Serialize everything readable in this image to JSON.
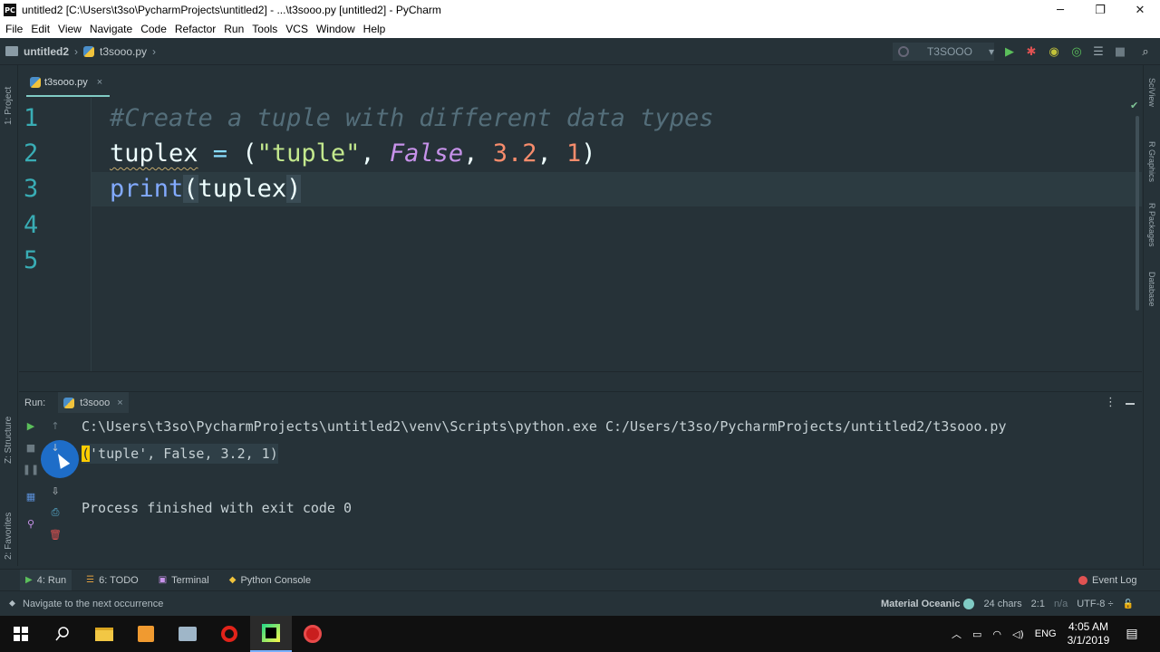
{
  "window": {
    "app_icon": "PC",
    "title": "untitled2 [C:\\Users\\t3so\\PycharmProjects\\untitled2] - ...\\t3sooo.py [untitled2] - PyCharm",
    "minimize": "─",
    "maximize": "❐",
    "close": "✕"
  },
  "menu": [
    "File",
    "Edit",
    "View",
    "Navigate",
    "Code",
    "Refactor",
    "Run",
    "Tools",
    "VCS",
    "Window",
    "Help"
  ],
  "breadcrumb": {
    "project": "untitled2",
    "file": "t3sooo.py",
    "sep": "›"
  },
  "run_config": {
    "name": "T3SOOO",
    "arrow": "▾"
  },
  "toolbar_icons": {
    "run": "▶",
    "debug": "✱",
    "coverage": "◉",
    "profile": "◎",
    "concurrency": "☰",
    "stop": "■",
    "search": "⌕"
  },
  "left_strip": {
    "project": "1: Project",
    "structure": "Z: Structure",
    "favorites": "2: Favorites"
  },
  "right_strip": {
    "sciview": "SciView",
    "rgraphics": "R Graphics",
    "rpackages": "R Packages",
    "database": "Database"
  },
  "editor_tab": {
    "label": "t3sooo.py",
    "close": "×"
  },
  "editor": {
    "line_numbers": [
      "1",
      "2",
      "3",
      "4",
      "5"
    ],
    "line1_comment": "#Create a tuple with different data types",
    "line2": {
      "var": "tuplex",
      "eq": " = ",
      "open": "(",
      "str": "\"tuple\"",
      "c1": ", ",
      "kw": "False",
      "c2": ", ",
      "n1": "3.2",
      "c3": ", ",
      "n2": "1",
      "close": ")"
    },
    "line3": {
      "fn": "print",
      "open": "(",
      "arg": "tuplex",
      "close": ")"
    }
  },
  "run_panel": {
    "label": "Run:",
    "tab": "t3sooo",
    "tab_close": "×",
    "more": "⋮",
    "command": "C:\\Users\\t3so\\PycharmProjects\\untitled2\\venv\\Scripts\\python.exe C:/Users/t3so/PycharmProjects/untitled2/t3sooo.py",
    "output_open": "(",
    "output_rest": "'tuple', False, 3.2, 1)",
    "exit_message": "Process finished with exit code 0"
  },
  "bottom_tools": [
    {
      "icon": "▶",
      "label": "4: Run"
    },
    {
      "icon": "☰",
      "label": "6: TODO"
    },
    {
      "icon": "▣",
      "label": "Terminal"
    },
    {
      "icon": "◆",
      "label": "Python Console"
    }
  ],
  "event_log": "Event Log",
  "status": {
    "icon": "⬥",
    "message": "Navigate to the next occurrence",
    "theme": "Material Oceanic",
    "chars": "24 chars",
    "position": "2:1",
    "na": "n/a",
    "encoding": "UTF-8 ÷",
    "lock": "🔓"
  },
  "taskbar": {
    "lang": "ENG",
    "time": "4:05 AM",
    "date": "3/1/2019"
  },
  "colors": {
    "background": "#263238",
    "line_numbers": "#39adb5",
    "string": "#c3e88d",
    "keyword": "#c792ea",
    "number": "#f78c6c",
    "function": "#82aaff",
    "comment": "#546e7a"
  }
}
